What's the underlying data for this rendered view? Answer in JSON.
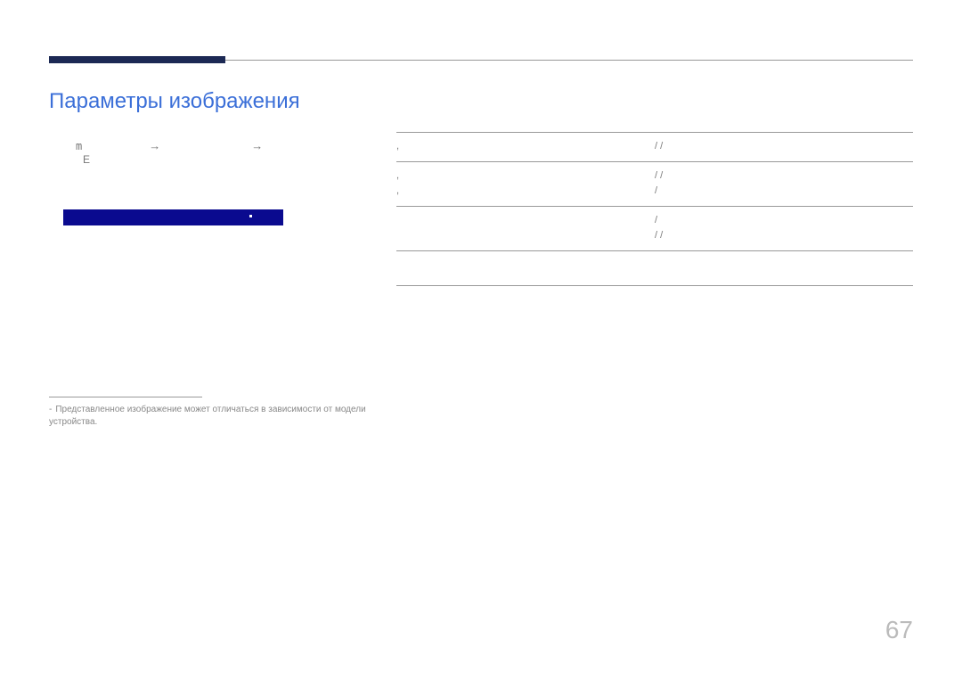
{
  "title": "Параметры изображения",
  "nav": {
    "menuGlyph": "m",
    "arrow": "→",
    "e": "E"
  },
  "rows": {
    "r1a": ",",
    "r1b": "/             /",
    "r2a": ",",
    "r2b": "/                /",
    "r2c": ",",
    "r2d": "/",
    "r3a": "/",
    "r3b": "/          /"
  },
  "footnote": "Представленное изображение может отличаться в зависимости от модели устройства.",
  "pageNumber": "67"
}
